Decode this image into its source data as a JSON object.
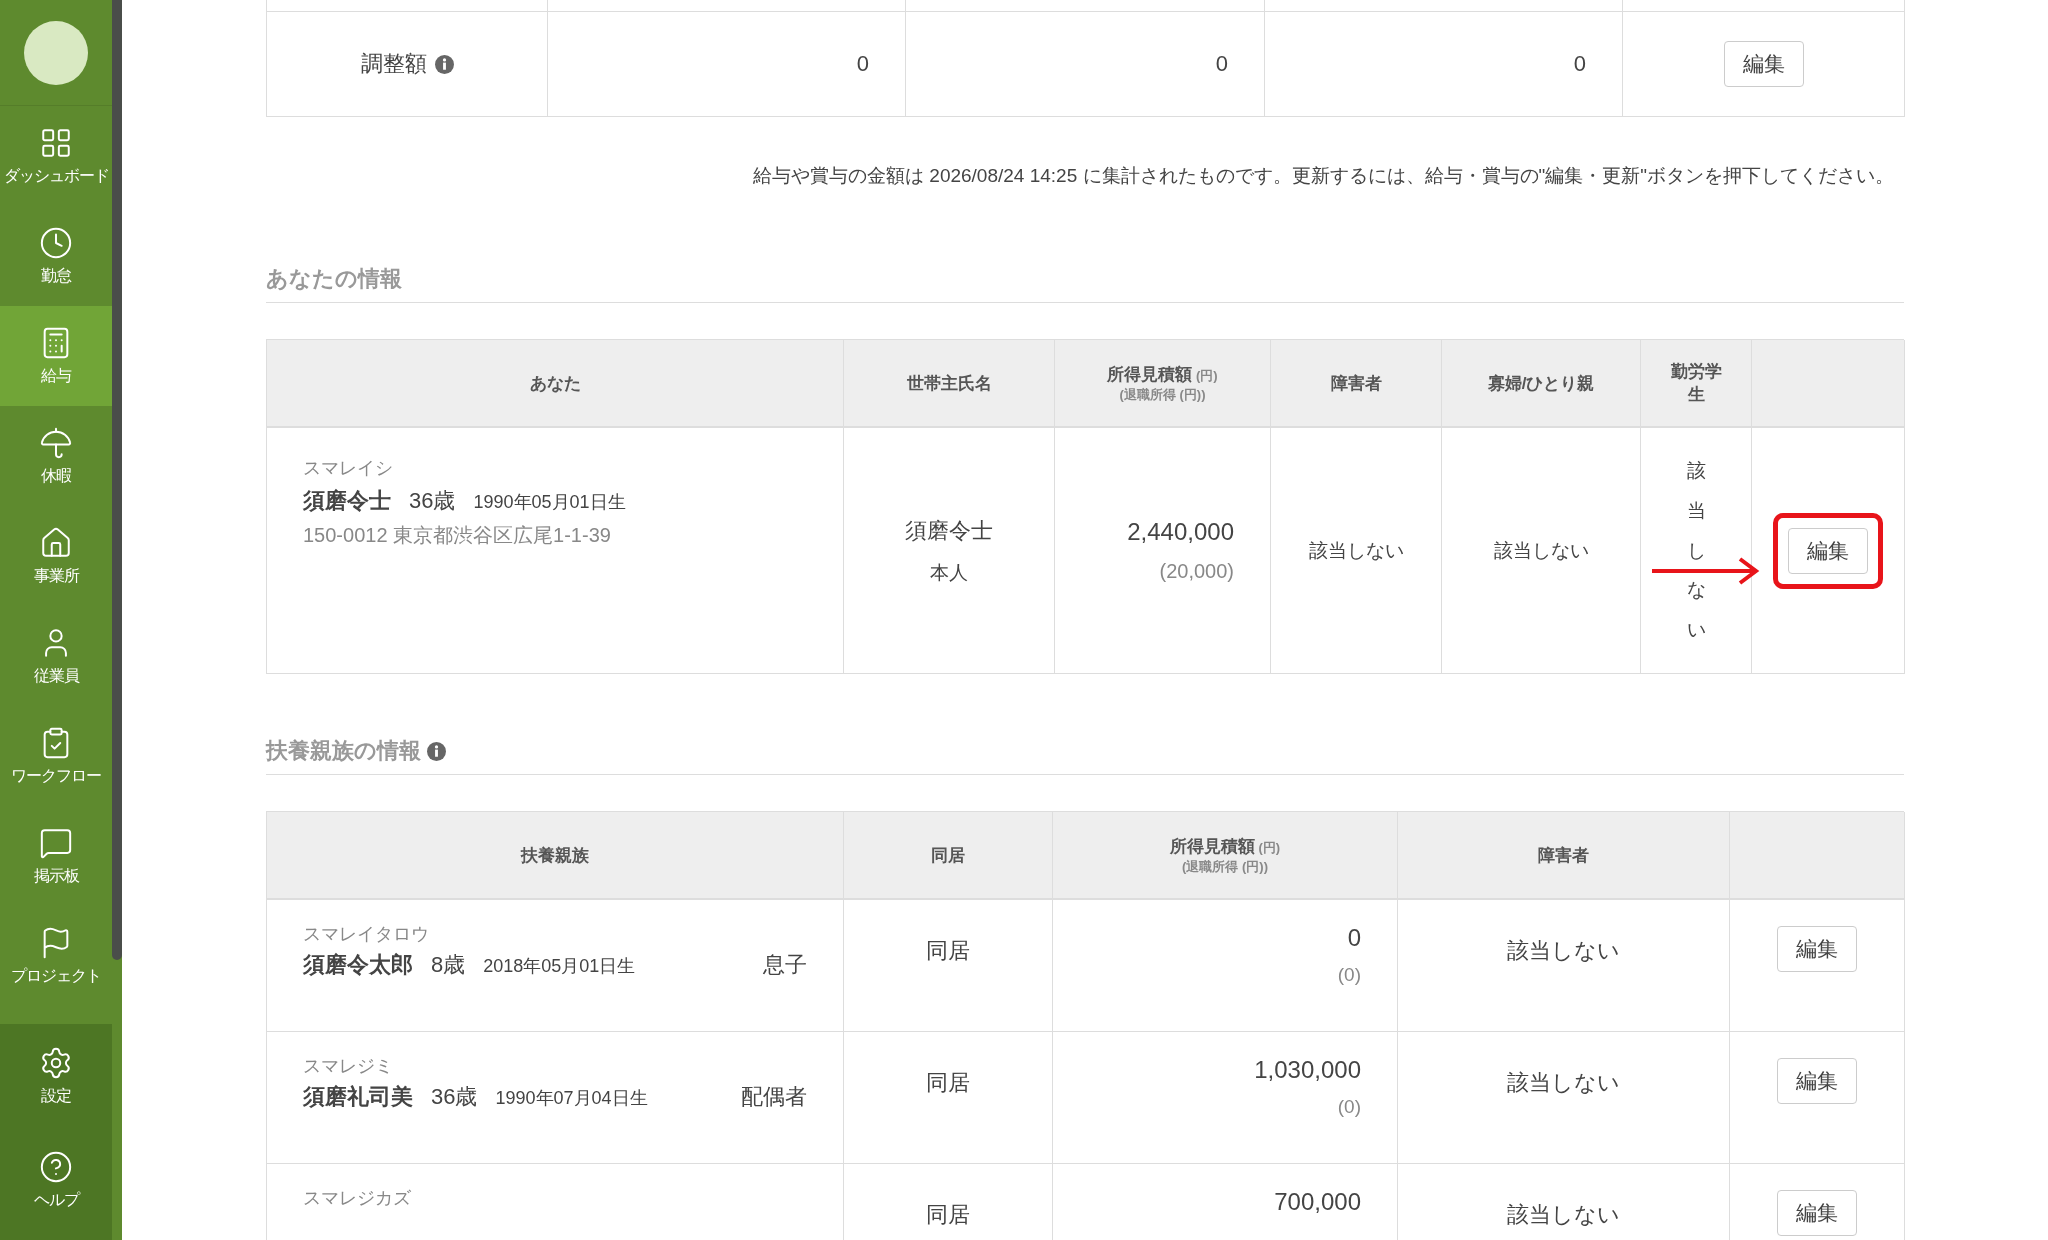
{
  "sidebar": {
    "items": [
      {
        "label": "ダッシュボード",
        "selected": false
      },
      {
        "label": "勤怠",
        "selected": false
      },
      {
        "label": "給与",
        "selected": true
      },
      {
        "label": "休暇",
        "selected": false
      },
      {
        "label": "事業所",
        "selected": false
      },
      {
        "label": "従業員",
        "selected": false
      },
      {
        "label": "ワークフロー",
        "selected": false
      },
      {
        "label": "掲示板",
        "selected": false
      },
      {
        "label": "プロジェクト",
        "selected": false
      }
    ],
    "footer_items": [
      {
        "label": "設定"
      },
      {
        "label": "ヘルプ"
      }
    ]
  },
  "adjustment_row": {
    "label": "調整額",
    "values": [
      "0",
      "0",
      "0"
    ],
    "button": "編集"
  },
  "note": "給与や賞与の金額は 2026/08/24 14:25 に集計されたものです。更新するには、給与・賞与の\"編集・更新\"ボタンを押下してください。",
  "your_info": {
    "title": "あなたの情報",
    "columns": [
      {
        "label": "あなた"
      },
      {
        "label": "世帯主氏名"
      },
      {
        "label": "所得見積額",
        "unit": "(円)",
        "sublabel": "(退職所得 (円))"
      },
      {
        "label": "障害者"
      },
      {
        "label": "寡婦/ひとり親"
      },
      {
        "label": "勤労学生"
      },
      {}
    ],
    "row": {
      "kana": "スマレイシ",
      "name": "須磨令士",
      "age": "36歳",
      "birth": "1990年05月01日生",
      "address": "150-0012 東京都渋谷区広尾1-1-39",
      "householder": "須磨令士",
      "relation": "本人",
      "income": "2,440,000",
      "retirement": "(20,000)",
      "disabled": "該当しない",
      "widow": "該当しない",
      "student": "該当しない",
      "button": "編集",
      "highlighted": true
    }
  },
  "dependents": {
    "title": "扶養親族の情報",
    "columns": [
      {
        "label": "扶養親族"
      },
      {
        "label": "同居"
      },
      {
        "label": "所得見積額",
        "unit": "(円)",
        "sublabel": "(退職所得 (円))"
      },
      {
        "label": "障害者"
      },
      {}
    ],
    "rows": [
      {
        "kana": "スマレイタロウ",
        "name": "須磨令太郎",
        "age": "8歳",
        "birth": "2018年05月01日生",
        "relation": "息子",
        "cohabit": "同居",
        "income": "0",
        "retirement": "(0)",
        "disabled": "該当しない",
        "button": "編集"
      },
      {
        "kana": "スマレジミ",
        "name": "須磨礼司美",
        "age": "36歳",
        "birth": "1990年07月04日生",
        "relation": "配偶者",
        "cohabit": "同居",
        "income": "1,030,000",
        "retirement": "(0)",
        "disabled": "該当しない",
        "button": "編集"
      },
      {
        "kana": "スマレジカズ",
        "cohabit": "同居",
        "income": "700,000",
        "disabled": "該当しない",
        "button": "編集"
      }
    ]
  }
}
